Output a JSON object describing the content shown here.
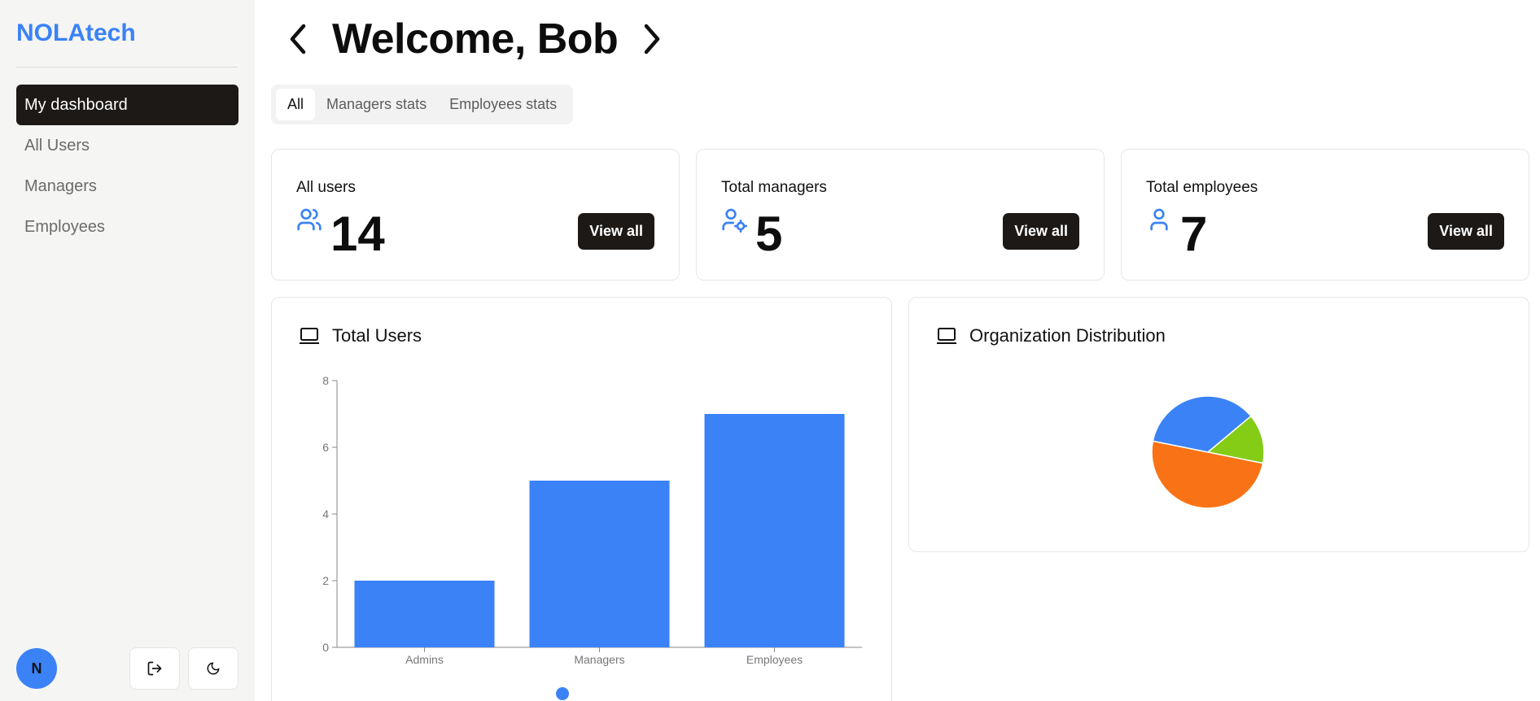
{
  "app": {
    "brand": "NOLAtech"
  },
  "sidebar": {
    "items": [
      {
        "label": "My dashboard",
        "active": true
      },
      {
        "label": "All Users",
        "active": false
      },
      {
        "label": "Managers",
        "active": false
      },
      {
        "label": "Employees",
        "active": false
      }
    ],
    "avatar_initial": "N",
    "icons": [
      "logout-icon",
      "moon-icon"
    ]
  },
  "header": {
    "title": "Welcome, Bob"
  },
  "tabs": [
    {
      "label": "All",
      "active": true
    },
    {
      "label": "Managers stats",
      "active": false
    },
    {
      "label": "Employees stats",
      "active": false
    }
  ],
  "stats": [
    {
      "label": "All users",
      "value": "14",
      "button": "View all",
      "icon": "users-icon"
    },
    {
      "label": "Total managers",
      "value": "5",
      "button": "View all",
      "icon": "user-cog-icon"
    },
    {
      "label": "Total employees",
      "value": "7",
      "button": "View all",
      "icon": "user-icon"
    }
  ],
  "panels": {
    "total_users_title": "Total Users",
    "org_distribution_title": "Organization Distribution"
  },
  "colors": {
    "accent": "#3b82f6",
    "dark": "#1c1917",
    "orange": "#f97316",
    "green": "#84cc16"
  },
  "chart_data": [
    {
      "type": "bar",
      "title": "Total Users",
      "categories": [
        "Admins",
        "Managers",
        "Employees"
      ],
      "values": [
        2,
        5,
        7
      ],
      "ylim": [
        0,
        8
      ],
      "yticks": [
        0,
        2,
        4,
        6,
        8
      ],
      "color": "#3b82f6",
      "grid": false
    },
    {
      "type": "pie",
      "title": "Organization Distribution",
      "slices": [
        {
          "value": 2,
          "color": "#84cc16"
        },
        {
          "value": 7,
          "color": "#f97316"
        },
        {
          "value": 5,
          "color": "#3b82f6"
        }
      ]
    }
  ]
}
